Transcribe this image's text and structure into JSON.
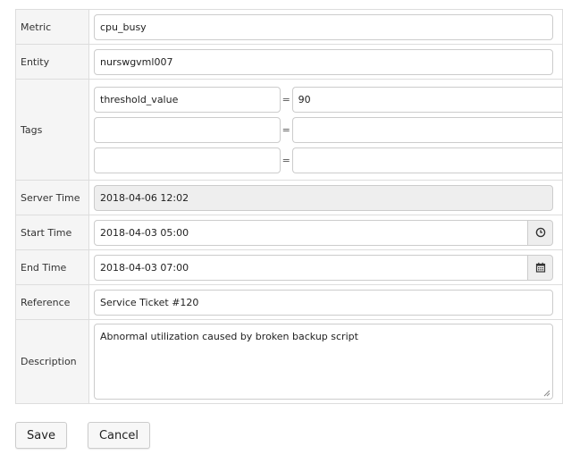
{
  "form": {
    "metric": {
      "label": "Metric",
      "value": "cpu_busy"
    },
    "entity": {
      "label": "Entity",
      "value": "nurswgvml007"
    },
    "tags": {
      "label": "Tags",
      "separator": "=",
      "rows": [
        {
          "key": "threshold_value",
          "value": "90"
        },
        {
          "key": "",
          "value": ""
        },
        {
          "key": "",
          "value": ""
        }
      ]
    },
    "server_time": {
      "label": "Server Time",
      "value": "2018-04-06 12:02"
    },
    "start_time": {
      "label": "Start Time",
      "value": "2018-04-03 05:00",
      "icon": "clock-icon"
    },
    "end_time": {
      "label": "End Time",
      "value": "2018-04-03 07:00",
      "icon": "calendar-icon"
    },
    "reference": {
      "label": "Reference",
      "value": "Service Ticket #120"
    },
    "description": {
      "label": "Description",
      "value": "Abnormal utilization caused by broken backup script"
    }
  },
  "buttons": {
    "save": "Save",
    "cancel": "Cancel"
  }
}
